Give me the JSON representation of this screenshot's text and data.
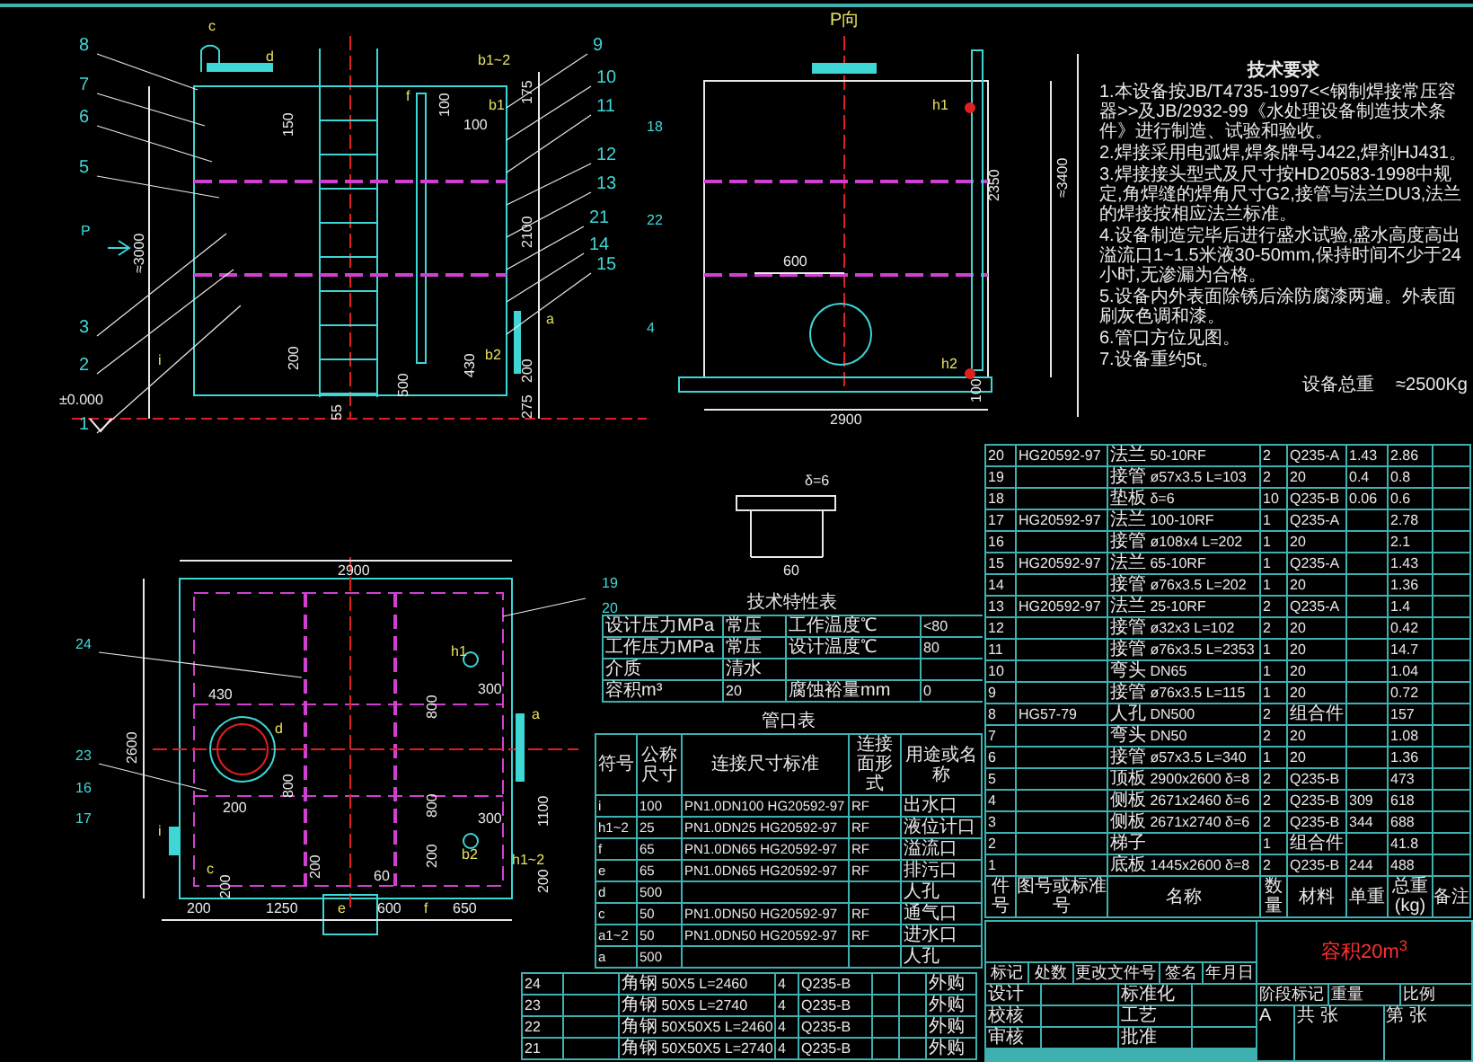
{
  "front_view": {
    "part_labels": [
      "8",
      "7",
      "6",
      "5",
      "3",
      "2",
      "1",
      "9",
      "10",
      "11",
      "12",
      "13",
      "21",
      "14",
      "15"
    ],
    "annotations": [
      "c",
      "d",
      "b1~2",
      "b1",
      "f",
      "i",
      "a",
      "b2",
      "P",
      "±0.000",
      "150",
      "100",
      "100",
      "175",
      "≈3000",
      "2100",
      "200",
      "430",
      "500",
      "55",
      "200",
      "275"
    ]
  },
  "side_view": {
    "labels": [
      "P向",
      "18",
      "22",
      "4",
      "h1",
      "h2",
      "≈3400",
      "2350",
      "600",
      "100",
      "2900"
    ]
  },
  "detail": {
    "labels": [
      "δ=6",
      "60"
    ]
  },
  "plan_view": {
    "labels": [
      "24",
      "23",
      "16",
      "17",
      "19",
      "20",
      "2900",
      "2600",
      "430",
      "d",
      "800",
      "200",
      "i",
      "c",
      "200",
      "200",
      "60",
      "200",
      "h1",
      "300",
      "800",
      "800",
      "300",
      "b2",
      "a",
      "1100",
      "h1~2",
      "200",
      "200",
      "1250",
      "e",
      "600",
      "f",
      "650"
    ]
  },
  "notes": {
    "title": "技术要求",
    "items": [
      "1.本设备按JB/T4735-1997<<钢制焊接常压容器>>及JB/2932-99《水处理设备制造技术条件》进行制造、试验和验收。",
      "2.焊接采用电弧焊,焊条牌号J422,焊剂HJ431。",
      "3.焊接接头型式及尺寸按HD20583-1998中规定,角焊缝的焊角尺寸G2,接管与法兰DU3,法兰的焊接按相应法兰标准。",
      "4.设备制造完毕后进行盛水试验,盛水高度高出溢流口1~1.5米液30-50mm,保持时间不少于24小时,无渗漏为合格。",
      "5.设备内外表面除锈后涂防腐漆两遍。外表面刷灰色调和漆。",
      "6.管口方位见图。",
      "7.设备重约5t。"
    ],
    "weight_label": "设备总重",
    "weight": "≈2500Kg"
  },
  "spec_table": {
    "title": "技术特性表",
    "rows": [
      [
        "设计压力MPa",
        "常压",
        "工作温度℃",
        "<80"
      ],
      [
        "工作压力MPa",
        "常压",
        "设计温度℃",
        "80"
      ],
      [
        "介质",
        "清水",
        "",
        ""
      ],
      [
        "容积m³",
        "20",
        "腐蚀裕量mm",
        "0"
      ]
    ]
  },
  "nozzle_table": {
    "title": "管口表",
    "columns": [
      "符号",
      "公称尺寸",
      "连接尺寸标准",
      "连接面形式",
      "用途或名称"
    ],
    "rows": [
      [
        "i",
        "100",
        "PN1.0DN100 HG20592-97",
        "RF",
        "出水口"
      ],
      [
        "h1~2",
        "25",
        "PN1.0DN25 HG20592-97",
        "RF",
        "液位计口"
      ],
      [
        "f",
        "65",
        "PN1.0DN65 HG20592-97",
        "RF",
        "溢流口"
      ],
      [
        "e",
        "65",
        "PN1.0DN65 HG20592-97",
        "RF",
        "排污口"
      ],
      [
        "d",
        "500",
        "",
        "",
        "人孔"
      ],
      [
        "c",
        "50",
        "PN1.0DN50 HG20592-97",
        "RF",
        "通气口"
      ],
      [
        "a1~2",
        "50",
        "PN1.0DN50 HG20592-97",
        "RF",
        "进水口"
      ],
      [
        "a",
        "500",
        "",
        "",
        "人孔"
      ]
    ]
  },
  "parts_table": {
    "bottom_header": [
      "件号",
      "图号或标准号",
      "名称",
      "数量",
      "材料",
      "单重",
      "总重(kg)",
      "备注"
    ],
    "rows": [
      [
        "20",
        "HG20592-97",
        "法兰 50-10RF",
        "2",
        "Q235-A",
        "1.43",
        "2.86"
      ],
      [
        "19",
        "",
        "接管 ø57x3.5 L=103",
        "2",
        "20",
        "0.4",
        "0.8"
      ],
      [
        "18",
        "",
        "垫板 δ=6",
        "10",
        "Q235-B",
        "0.06",
        "0.6"
      ],
      [
        "17",
        "HG20592-97",
        "法兰 100-10RF",
        "1",
        "Q235-A",
        "",
        "2.78"
      ],
      [
        "16",
        "",
        "接管 ø108x4 L=202",
        "1",
        "20",
        "",
        "2.1"
      ],
      [
        "15",
        "HG20592-97",
        "法兰 65-10RF",
        "1",
        "Q235-A",
        "",
        "1.43"
      ],
      [
        "14",
        "",
        "接管 ø76x3.5 L=202",
        "1",
        "20",
        "",
        "1.36"
      ],
      [
        "13",
        "HG20592-97",
        "法兰 25-10RF",
        "2",
        "Q235-A",
        "",
        "1.4"
      ],
      [
        "12",
        "",
        "接管 ø32x3 L=102",
        "2",
        "20",
        "",
        "0.42"
      ],
      [
        "11",
        "",
        "接管 ø76x3.5 L=2353",
        "1",
        "20",
        "",
        "14.7"
      ],
      [
        "10",
        "",
        "弯头 DN65",
        "1",
        "20",
        "",
        "1.04"
      ],
      [
        "9",
        "",
        "接管 ø76x3.5 L=115",
        "1",
        "20",
        "",
        "0.72"
      ],
      [
        "8",
        "HG57-79",
        "人孔 DN500",
        "2",
        "组合件",
        "",
        "157"
      ],
      [
        "7",
        "",
        "弯头 DN50",
        "2",
        "20",
        "",
        "1.08"
      ],
      [
        "6",
        "",
        "接管 ø57x3.5 L=340",
        "1",
        "20",
        "",
        "1.36"
      ],
      [
        "5",
        "",
        "顶板 2900x2600 δ=8",
        "2",
        "Q235-B",
        "",
        "473"
      ],
      [
        "4",
        "",
        "侧板 2671x2460 δ=6",
        "2",
        "Q235-B",
        "309",
        "618"
      ],
      [
        "3",
        "",
        "侧板 2671x2740 δ=6",
        "2",
        "Q235-B",
        "344",
        "688"
      ],
      [
        "2",
        "",
        "梯子",
        "1",
        "组合件",
        "",
        "41.8"
      ],
      [
        "1",
        "",
        "底板 1445x2600 δ=8",
        "2",
        "Q235-B",
        "244",
        "488"
      ]
    ]
  },
  "lower_table": {
    "rows": [
      [
        "24",
        "",
        "角钢 50X5 L=2460",
        "4",
        "Q235-B",
        "",
        "",
        "外购"
      ],
      [
        "23",
        "",
        "角钢 50X5 L=2740",
        "4",
        "Q235-B",
        "",
        "",
        "外购"
      ],
      [
        "22",
        "",
        "角钢 50X50X5 L=2460",
        "4",
        "Q235-B",
        "",
        "",
        "外购"
      ],
      [
        "21",
        "",
        "角钢 50X50X5 L=2740",
        "4",
        "Q235-B",
        "",
        "",
        "外购"
      ]
    ]
  },
  "title_block": {
    "drawing_title": "容积20m$^{3}$",
    "revision_headers": [
      "标记",
      "处数",
      "更改文件号",
      "签名",
      "年月日"
    ],
    "sign_rows": [
      [
        "设计",
        "标准化"
      ],
      [
        "校核",
        "工艺"
      ],
      [
        "审核",
        "批准"
      ]
    ],
    "stage_labels": [
      "阶段标记",
      "重量",
      "比例"
    ],
    "stage_value": "A",
    "sheet_labels": [
      "共 张",
      "第 张"
    ]
  }
}
